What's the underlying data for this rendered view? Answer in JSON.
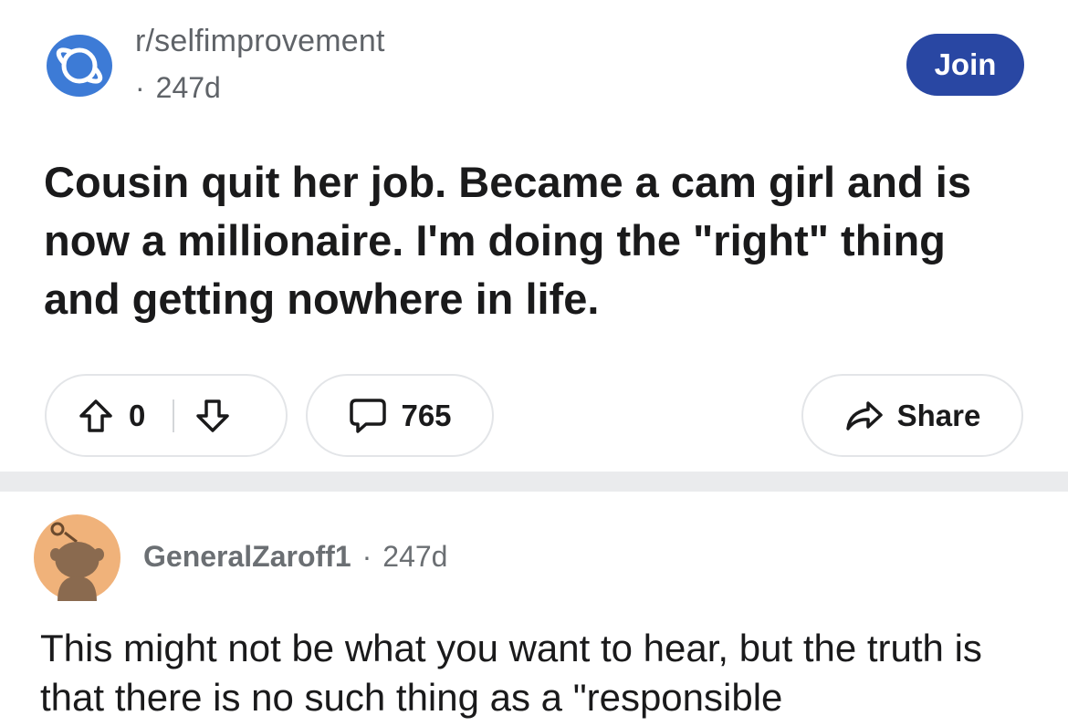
{
  "post": {
    "subreddit": "r/selfimprovement",
    "age": "247d",
    "join_label": "Join",
    "title": "Cousin quit her job. Became a cam girl and is now a millionaire. I'm doing the \"right\" thing and getting nowhere in life.",
    "score": "0",
    "comments_count": "765",
    "share_label": "Share"
  },
  "comment": {
    "username": "GeneralZaroff1",
    "age": "247d",
    "body": "This might not be what you want to hear, but the truth is that there is no such thing as a \"responsible"
  },
  "colors": {
    "join_button": "#2947a3",
    "subreddit_icon": "#3d7bd6",
    "avatar_bg": "#f0b27a",
    "separator": "#eaebed"
  },
  "icons": {
    "subreddit": "planet-icon",
    "upvote": "arrow-up-icon",
    "downvote": "arrow-down-icon",
    "comments": "speech-bubble-icon",
    "share": "share-arrow-icon",
    "avatar": "snoo-avatar-icon"
  }
}
